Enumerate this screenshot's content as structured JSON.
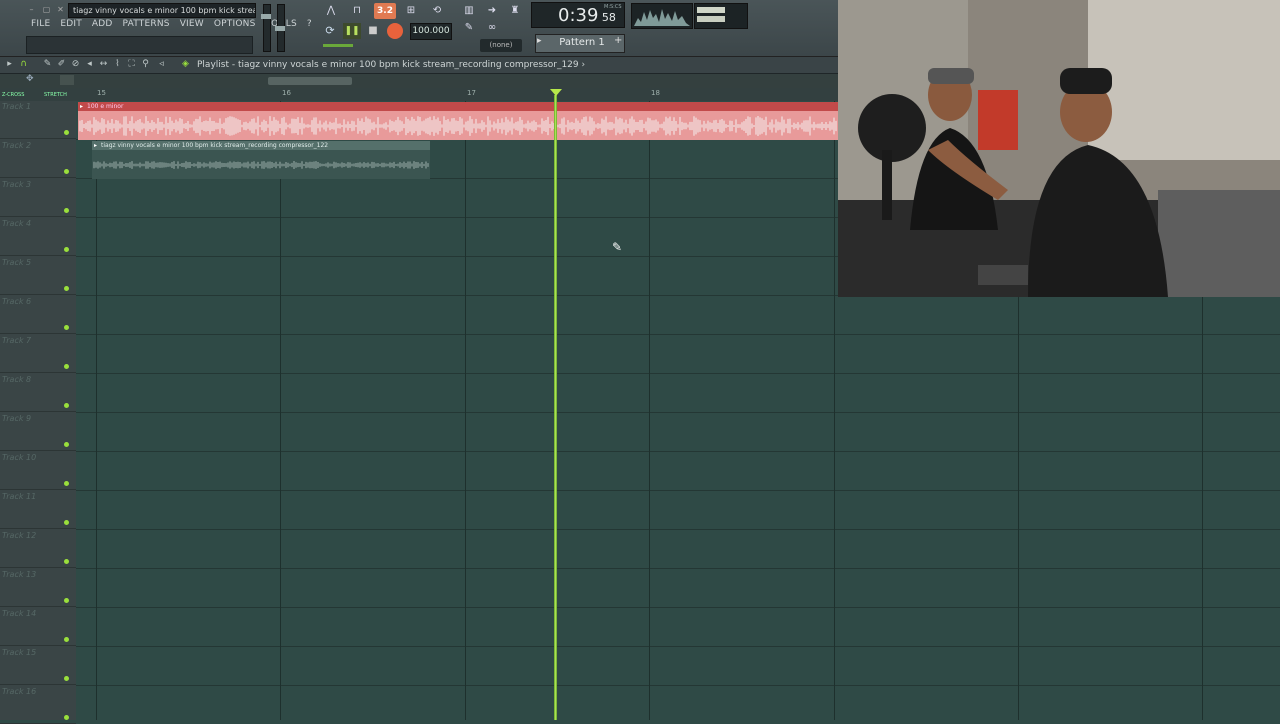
{
  "window": {
    "title": "tiagz vinny vocals e minor 100 bpm kick stream...",
    "controls": [
      "–",
      "▢",
      "✕"
    ]
  },
  "menu": [
    "FILE",
    "EDIT",
    "ADD",
    "PATTERNS",
    "VIEW",
    "OPTIONS",
    "TOOLS",
    "?"
  ],
  "transport": {
    "snap_indicator": "3.2",
    "tempo": "100.000",
    "time_main": "0:39",
    "time_sub": "58",
    "time_unit_label": "M:S:CS",
    "pattern": "Pattern 1",
    "snap_select": "(none)",
    "play_icon": "pause-icon",
    "stop_icon": "stop-icon",
    "record_icon": "record-icon",
    "accent_record": "#e8623c",
    "accent_playhead": "#9ae03c"
  },
  "playlist": {
    "title": "Playlist - tiagz vinny vocals e minor 100 bpm kick stream_recording compressor_129",
    "zoom_labels": [
      "Z-CROSS",
      "STRETCH"
    ],
    "ruler": [
      "15",
      "16",
      "17",
      "18"
    ],
    "tracks": [
      "Track 1",
      "Track 2",
      "Track 3",
      "Track 4",
      "Track 5",
      "Track 6",
      "Track 7",
      "Track 8",
      "Track 9",
      "Track 10",
      "Track 11",
      "Track 12",
      "Track 13",
      "Track 14",
      "Track 15",
      "Track 16"
    ],
    "clips": [
      {
        "name": "100 e minor",
        "color": "#e89a9a",
        "header_color": "#c24a4a"
      },
      {
        "name": "tiagz vinny vocals e minor 100 bpm kick stream_recording compressor_122",
        "color": "#3b5551",
        "header_color": "#55706b"
      }
    ]
  }
}
